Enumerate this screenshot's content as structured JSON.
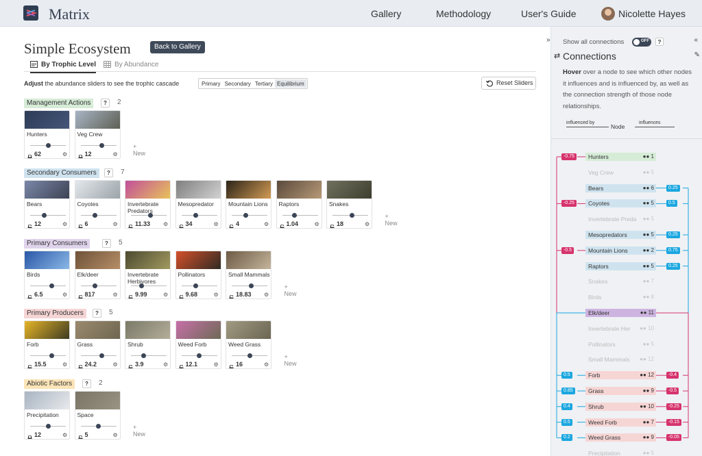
{
  "app": {
    "name": "Matrix"
  },
  "nav": {
    "gallery": "Gallery",
    "methodology": "Methodology",
    "guide": "User's Guide",
    "user": "Nicolette Hayes"
  },
  "page": {
    "title": "Simple Ecosystem",
    "back": "Back to Gallery",
    "tabs": {
      "trophic": "By Trophic Level",
      "abundance": "By Abundance"
    },
    "adjust_bold": "Adjust",
    "adjust_rest": " the abundance sliders to see the trophic cascade",
    "presets": [
      "Primary",
      "Secondary",
      "Tertiary",
      "Equilibrium"
    ],
    "reset": "Reset Sliders",
    "new_label": "New"
  },
  "groups": [
    {
      "name": "Management Actions",
      "count": "2",
      "color": "#d6ecd7",
      "items": [
        {
          "name": "Hunters",
          "value": "62",
          "lock": "locked",
          "knob": 0.5,
          "img": [
            "#2d3c56",
            "#46567a"
          ]
        },
        {
          "name": "Veg Crew",
          "value": "12",
          "lock": "locked",
          "knob": 0.6,
          "img": [
            "#a7b4c4",
            "#5d5f53"
          ]
        }
      ]
    },
    {
      "name": "Secondary Consumers",
      "count": "7",
      "color": "#cfe3ef",
      "items": [
        {
          "name": "Bears",
          "value": "12",
          "lock": "unlocked",
          "knob": 0.4,
          "img": [
            "#7a87a8",
            "#3c4252"
          ]
        },
        {
          "name": "Coyotes",
          "value": "6",
          "lock": "unlocked",
          "knob": 0.4,
          "img": [
            "#e4e8ec",
            "#9aa3a8"
          ]
        },
        {
          "name": "Invertebrate Predators",
          "value": "11.33",
          "lock": "unlocked",
          "knob": 0.55,
          "img": [
            "#c24f9a",
            "#e8c35a"
          ]
        },
        {
          "name": "Mesopredator",
          "value": "34",
          "lock": "unlocked",
          "knob": 0.4,
          "img": [
            "#7f7f7f",
            "#d3d3d3"
          ]
        },
        {
          "name": "Mountain Lions",
          "value": "4",
          "lock": "unlocked",
          "knob": 0.4,
          "img": [
            "#2b2418",
            "#d49c56"
          ]
        },
        {
          "name": "Raptors",
          "value": "1.04",
          "lock": "unlocked",
          "knob": 0.35,
          "img": [
            "#5a4a3c",
            "#b89a78"
          ]
        },
        {
          "name": "Snakes",
          "value": "18",
          "lock": "unlocked",
          "knob": 0.55,
          "img": [
            "#70705e",
            "#3d3e2f"
          ]
        }
      ]
    },
    {
      "name": "Primary Consumers",
      "count": "5",
      "color": "#e0d4ec",
      "items": [
        {
          "name": "Birds",
          "value": "6.5",
          "lock": "unlocked",
          "knob": 0.6,
          "img": [
            "#2a58a8",
            "#8bb8e6"
          ]
        },
        {
          "name": "Elk/deer",
          "value": "817",
          "lock": "unlocked",
          "knob": 0.4,
          "img": [
            "#6f5238",
            "#b68f68"
          ]
        },
        {
          "name": "Invertebrate Herbivores",
          "value": "9.99",
          "lock": "unlocked",
          "knob": 0.3,
          "img": [
            "#4c4a30",
            "#a29a60"
          ]
        },
        {
          "name": "Pollinators",
          "value": "9.68",
          "lock": "unlocked",
          "knob": 0.4,
          "img": [
            "#d4502a",
            "#2f2a24"
          ]
        },
        {
          "name": "Small Mammals",
          "value": "18.83",
          "lock": "unlocked",
          "knob": 0.55,
          "img": [
            "#6d5a45",
            "#c5b69c"
          ]
        }
      ]
    },
    {
      "name": "Primary Producers",
      "count": "5",
      "color": "#f6d5d5",
      "items": [
        {
          "name": "Forb",
          "value": "15.5",
          "lock": "unlocked",
          "knob": 0.6,
          "img": [
            "#e6b528",
            "#3c3a22"
          ]
        },
        {
          "name": "Grass",
          "value": "24.2",
          "lock": "unlocked",
          "knob": 0.6,
          "img": [
            "#9a8a6e",
            "#6e6650"
          ]
        },
        {
          "name": "Shrub",
          "value": "3.9",
          "lock": "unlocked",
          "knob": 0.35,
          "img": [
            "#7a7a68",
            "#b4ae9a"
          ]
        },
        {
          "name": "Weed Forb",
          "value": "12.1",
          "lock": "unlocked",
          "knob": 0.5,
          "img": [
            "#c76fa8",
            "#6d6a55"
          ]
        },
        {
          "name": "Weed Grass",
          "value": "16",
          "lock": "unlocked",
          "knob": 0.5,
          "img": [
            "#a19a82",
            "#6a6552"
          ]
        }
      ]
    },
    {
      "name": "Abiotic Factors",
      "count": "2",
      "color": "#fbe4b7",
      "items": [
        {
          "name": "Precipitation",
          "value": "12",
          "lock": "locked",
          "knob": 0.5,
          "img": [
            "#a8b4c2",
            "#e8eaec"
          ]
        },
        {
          "name": "Space",
          "value": "5",
          "lock": "unlocked",
          "knob": 0.5,
          "img": [
            "#7a7466",
            "#9a9484"
          ]
        }
      ]
    }
  ],
  "panel": {
    "show_all": "Show all connections",
    "toggle": "OFF",
    "title": "Connections",
    "desc_bold": "Hover",
    "desc_rest": " over a node to see which other nodes it influences and is influenced by, as well as the connection strength of those node relationships.",
    "influenced_by": "influenced by",
    "node": "Node",
    "influences": "influences",
    "nodes": [
      {
        "name": "Hunters",
        "count": "1",
        "color": "#d6ecd7",
        "active": true
      },
      {
        "name": "Veg Crew",
        "count": "5",
        "color": "",
        "active": false
      },
      {
        "name": "Bears",
        "count": "6",
        "color": "#cfe3ef",
        "active": true
      },
      {
        "name": "Coyotes",
        "count": "5",
        "color": "#cfe3ef",
        "active": true
      },
      {
        "name": "Invertebrate Preda",
        "count": "5",
        "color": "",
        "active": false
      },
      {
        "name": "Mesopredators",
        "count": "5",
        "color": "#cfe3ef",
        "active": true
      },
      {
        "name": "Mountain Lions",
        "count": "2",
        "color": "#cfe3ef",
        "active": true
      },
      {
        "name": "Raptors",
        "count": "5",
        "color": "#cfe3ef",
        "active": true
      },
      {
        "name": "Snakes",
        "count": "7",
        "color": "",
        "active": false
      },
      {
        "name": "Birds",
        "count": "8",
        "color": "",
        "active": false
      },
      {
        "name": "Elk/deer",
        "count": "11",
        "color": "#cdb4e0",
        "active": true
      },
      {
        "name": "Invertebrate Her",
        "count": "10",
        "color": "",
        "active": false
      },
      {
        "name": "Pollinators",
        "count": "5",
        "color": "",
        "active": false
      },
      {
        "name": "Small Mammals",
        "count": "12",
        "color": "",
        "active": false
      },
      {
        "name": "Forb",
        "count": "12",
        "color": "#f6d5d5",
        "active": true
      },
      {
        "name": "Grass",
        "count": "9",
        "color": "#f6d5d5",
        "active": true
      },
      {
        "name": "Shrub",
        "count": "10",
        "color": "#f6d5d5",
        "active": true
      },
      {
        "name": "Weed Forb",
        "count": "7",
        "color": "#f6d5d5",
        "active": true
      },
      {
        "name": "Weed Grass",
        "count": "9",
        "color": "#f6d5d5",
        "active": true
      },
      {
        "name": "Precipitation",
        "count": "5",
        "color": "",
        "active": false
      }
    ],
    "left_tags": [
      {
        "row": 0,
        "label": "-0.75",
        "sign": "neg"
      },
      {
        "row": 3,
        "label": "-0.25",
        "sign": "neg"
      },
      {
        "row": 6,
        "label": "-0.5",
        "sign": "neg"
      },
      {
        "row": 14,
        "label": "0.5",
        "sign": "pos"
      },
      {
        "row": 15,
        "label": "0.85",
        "sign": "pos"
      },
      {
        "row": 16,
        "label": "0.4",
        "sign": "pos"
      },
      {
        "row": 17,
        "label": "0.5",
        "sign": "pos"
      },
      {
        "row": 18,
        "label": "0.2",
        "sign": "pos"
      }
    ],
    "right_tags": [
      {
        "row": 2,
        "label": "0.25",
        "sign": "pos"
      },
      {
        "row": 3,
        "label": "0.5",
        "sign": "pos"
      },
      {
        "row": 5,
        "label": "0.25",
        "sign": "pos"
      },
      {
        "row": 6,
        "label": "0.75",
        "sign": "pos"
      },
      {
        "row": 7,
        "label": "0.25",
        "sign": "pos"
      },
      {
        "row": 14,
        "label": "-0.4",
        "sign": "neg"
      },
      {
        "row": 15,
        "label": "-0.5",
        "sign": "neg"
      },
      {
        "row": 16,
        "label": "-0.25",
        "sign": "neg"
      },
      {
        "row": 17,
        "label": "-0.15",
        "sign": "neg"
      },
      {
        "row": 18,
        "label": "-0.05",
        "sign": "neg"
      }
    ]
  }
}
